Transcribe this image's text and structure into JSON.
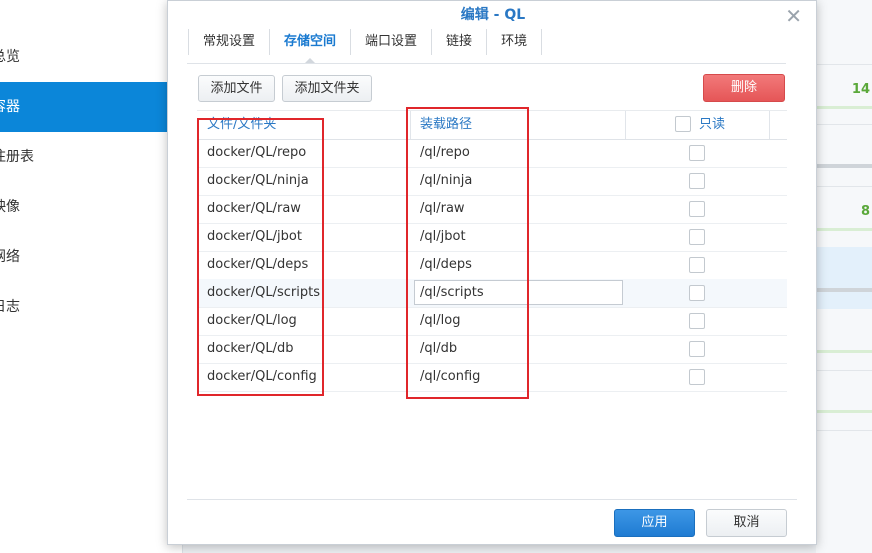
{
  "sidebar": {
    "items": [
      {
        "label": "总览"
      },
      {
        "label": "容器",
        "active": true
      },
      {
        "label": "注册表"
      },
      {
        "label": "映像"
      },
      {
        "label": "网络"
      },
      {
        "label": "日志"
      }
    ]
  },
  "background_panel": {
    "numbers": [
      "14",
      "8"
    ]
  },
  "dialog": {
    "title": "编辑 - QL",
    "tabs": [
      {
        "label": "常规设置"
      },
      {
        "label": "存储空间",
        "active": true
      },
      {
        "label": "端口设置"
      },
      {
        "label": "链接"
      },
      {
        "label": "环境"
      }
    ],
    "toolbar": {
      "add_file": "添加文件",
      "add_folder": "添加文件夹",
      "delete": "删除"
    },
    "table": {
      "headers": {
        "path": "文件/文件夹",
        "mount": "装载路径",
        "readonly": "只读"
      },
      "rows": [
        {
          "path": "docker/QL/repo",
          "mount": "/ql/repo",
          "readonly": false
        },
        {
          "path": "docker/QL/ninja",
          "mount": "/ql/ninja",
          "readonly": false
        },
        {
          "path": "docker/QL/raw",
          "mount": "/ql/raw",
          "readonly": false
        },
        {
          "path": "docker/QL/jbot",
          "mount": "/ql/jbot",
          "readonly": false
        },
        {
          "path": "docker/QL/deps",
          "mount": "/ql/deps",
          "readonly": false
        },
        {
          "path": "docker/QL/scripts",
          "mount": "/ql/scripts",
          "readonly": false,
          "editing": true
        },
        {
          "path": "docker/QL/log",
          "mount": "/ql/log",
          "readonly": false
        },
        {
          "path": "docker/QL/db",
          "mount": "/ql/db",
          "readonly": false
        },
        {
          "path": "docker/QL/config",
          "mount": "/ql/config",
          "readonly": false
        }
      ]
    },
    "footer": {
      "apply": "应用",
      "cancel": "取消"
    }
  },
  "colors": {
    "accent": "#0b86d9",
    "highlight_box": "#e0262b",
    "delete_button": "#e55657"
  }
}
